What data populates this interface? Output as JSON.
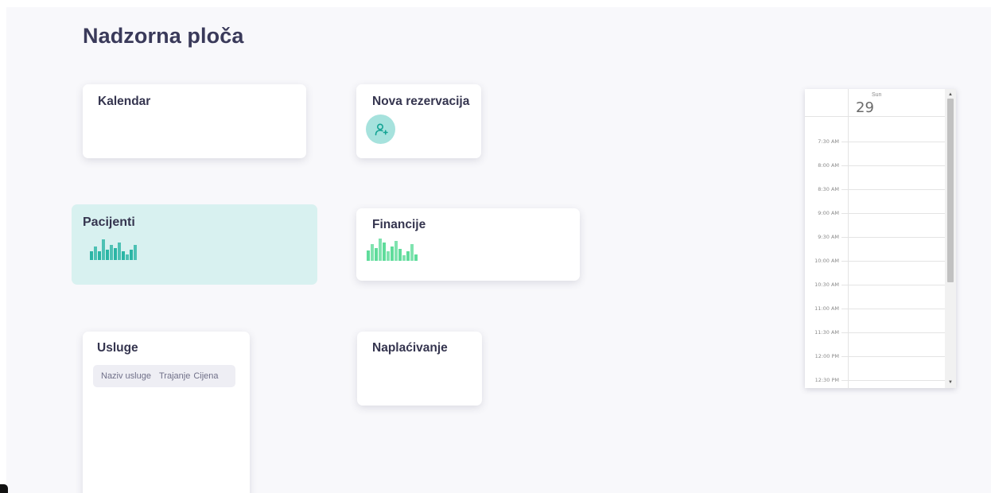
{
  "page": {
    "title": "Nadzorna ploča"
  },
  "cards": {
    "kalendar": {
      "title": "Kalendar"
    },
    "nova_rezervacija": {
      "title": "Nova rezervacija",
      "button_icon": "add-user-icon"
    },
    "pacijenti": {
      "title": "Pacijenti",
      "bar_color": "#2bb5a5",
      "sparkline": [
        6,
        9,
        6,
        14,
        7,
        10,
        8,
        12,
        6,
        4,
        7,
        10
      ]
    },
    "financije": {
      "title": "Financije",
      "bar_color": "#5fdc9b",
      "sparkline": [
        8,
        13,
        10,
        17,
        14,
        7,
        11,
        15,
        9,
        4,
        7,
        13,
        5
      ]
    },
    "usluge": {
      "title": "Usluge",
      "columns": [
        "Naziv usluge",
        "Trajanje",
        "Cijena"
      ]
    },
    "naplacivanje": {
      "title": "Naplaćivanje"
    }
  },
  "calendar": {
    "day_of_week": "Sun",
    "day_number": "29",
    "times": [
      "7:30 AM",
      "8:00 AM",
      "8:30 AM",
      "9:00 AM",
      "9:30 AM",
      "10:00 AM",
      "10:30 AM",
      "11:00 AM",
      "11:30 AM",
      "12:00 PM",
      "12:30 PM"
    ]
  }
}
